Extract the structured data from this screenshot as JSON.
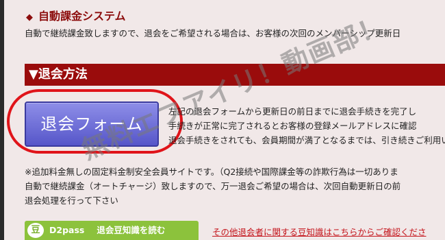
{
  "section1": {
    "bullet": "◆",
    "heading": "自動課金システム",
    "text": "自動で継続課金致しますので、退会をご希望される場合は、お客様の次回のメンバーシップ更新日"
  },
  "section2": {
    "heading": "▼退会方法",
    "button_label": "退会フォーム",
    "instructions": [
      "左記の退会フォームから更新日の前日までに退会手続きを完了し",
      "手続きが正常に完了されるとお客様の登録メールアドレスに確認",
      "退会手続きをされても、会員期間が満了となるまでは、引き続きご利用い"
    ]
  },
  "notes": [
    "※追加料金無しの固定料金制安全会員サイトです。（Q2接続や国際課金等の詐欺行為は一切ありま",
    "自動で継続課金（オートチャージ）致しますので、万一退会ご希望の場合は、次回自動更新日の前",
    "退会処理を行って下さい"
  ],
  "footer": {
    "icon_glyph": "豆",
    "d2pass": "D2pass",
    "tips_link": "退会豆知識を読む",
    "other_link": "その他退会者に関する豆知識はこちらからご確認くださ"
  },
  "watermark": "無料エフアイリ！動画部！",
  "colors": {
    "background": "#f1e8e8",
    "accent_red": "#9a0c0c",
    "button_blue": "#6a6ad6",
    "highlight": "#e0141a",
    "green": "#8cc23c"
  }
}
